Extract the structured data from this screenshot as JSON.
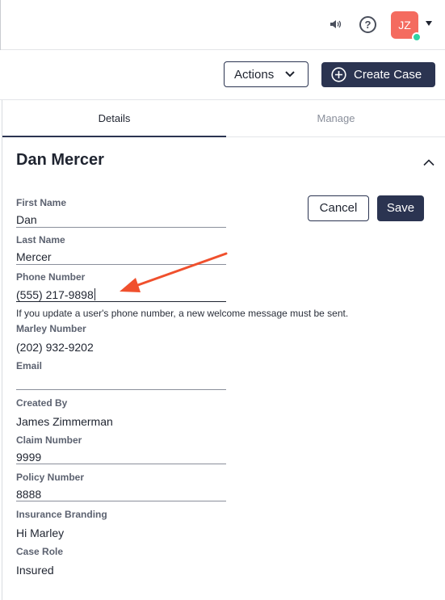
{
  "header": {
    "avatar_initials": "JZ",
    "icons": [
      "speaker-icon",
      "help-icon",
      "chevron-down-icon"
    ],
    "help_symbol": "?"
  },
  "toolbar": {
    "actions_label": "Actions",
    "create_case_label": "Create Case"
  },
  "tabs": [
    {
      "label": "Details",
      "active": true
    },
    {
      "label": "Manage",
      "active": false
    }
  ],
  "contact": {
    "name": "Dan Mercer",
    "cancel_label": "Cancel",
    "save_label": "Save",
    "fields": {
      "first_name": {
        "label": "First Name",
        "value": "Dan"
      },
      "last_name": {
        "label": "Last Name",
        "value": "Mercer"
      },
      "phone_number": {
        "label": "Phone Number",
        "value": "(555) 217-9898"
      },
      "phone_hint": "If you update a user's phone number, a new welcome message must be sent.",
      "marley_number": {
        "label": "Marley Number",
        "value": "(202) 932-9202"
      },
      "email": {
        "label": "Email",
        "value": ""
      },
      "created_by": {
        "label": "Created By",
        "value": "James Zimmerman"
      },
      "claim_number": {
        "label": "Claim Number",
        "value": "9999"
      },
      "policy_number": {
        "label": "Policy Number",
        "value": "8888"
      },
      "insurance_branding": {
        "label": "Insurance Branding",
        "value": "Hi Marley"
      },
      "case_role": {
        "label": "Case Role",
        "value": "Insured"
      }
    }
  },
  "colors": {
    "primary": "#2b3451",
    "avatar": "#f46b5f",
    "online": "#2fd3a4",
    "annotation_arrow": "#f0502d"
  }
}
